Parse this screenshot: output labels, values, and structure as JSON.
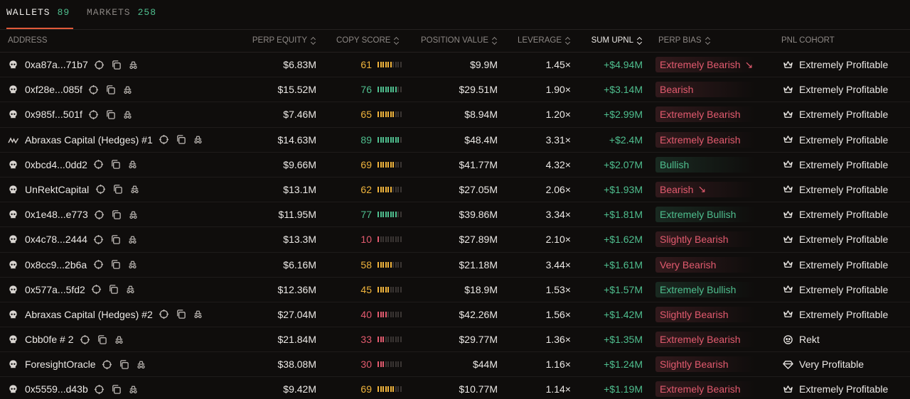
{
  "tabs": [
    {
      "label": "WALLETS",
      "count": "89",
      "active": true
    },
    {
      "label": "MARKETS",
      "count": "258",
      "active": false
    }
  ],
  "columns": {
    "address": "ADDRESS",
    "perp_equity": "PERP EQUITY",
    "copy_score": "COPY SCORE",
    "position_value": "POSITION VALUE",
    "leverage": "LEVERAGE",
    "sum_upnl": "SUM UPNL",
    "perp_bias": "PERP BIAS",
    "pnl_cohort": "PNL COHORT"
  },
  "colors": {
    "accent": "#e25a3a",
    "positive": "#4fbf8f",
    "bearish": "#e35b6f",
    "score_high": "#4fbf8f",
    "score_mid": "#f0b43c",
    "score_low": "#e35b6f"
  },
  "rows": [
    {
      "avatar": "skull-icon",
      "address": "0xa87a...71b7",
      "equity": "$6.83M",
      "score": "61",
      "position": "$9.9M",
      "leverage": "1.45×",
      "upnl": "+$4.94M",
      "bias": "Extremely Bearish",
      "bias_tone": "bear",
      "bias_arrow": "↘",
      "cohort_icon": "crown-icon",
      "cohort": "Extremely Profitable"
    },
    {
      "avatar": "skull-icon",
      "address": "0xf28e...085f",
      "equity": "$15.52M",
      "score": "76",
      "position": "$29.51M",
      "leverage": "1.90×",
      "upnl": "+$3.14M",
      "bias": "Bearish",
      "bias_tone": "bear",
      "bias_arrow": "",
      "cohort_icon": "crown-icon",
      "cohort": "Extremely Profitable"
    },
    {
      "avatar": "skull-icon",
      "address": "0x985f...501f",
      "equity": "$7.46M",
      "score": "65",
      "position": "$8.94M",
      "leverage": "1.20×",
      "upnl": "+$2.99M",
      "bias": "Extremely Bearish",
      "bias_tone": "bear",
      "bias_arrow": "",
      "cohort_icon": "crown-icon",
      "cohort": "Extremely Profitable"
    },
    {
      "avatar": "abraxas-logo-icon",
      "address": "Abraxas Capital (Hedges) #1",
      "equity": "$14.63M",
      "score": "89",
      "position": "$48.4M",
      "leverage": "3.31×",
      "upnl": "+$2.4M",
      "bias": "Extremely Bearish",
      "bias_tone": "bear",
      "bias_arrow": "",
      "cohort_icon": "crown-icon",
      "cohort": "Extremely Profitable"
    },
    {
      "avatar": "skull-icon",
      "address": "0xbcd4...0dd2",
      "equity": "$9.66M",
      "score": "69",
      "position": "$41.77M",
      "leverage": "4.32×",
      "upnl": "+$2.07M",
      "bias": "Bullish",
      "bias_tone": "bull",
      "bias_arrow": "",
      "cohort_icon": "crown-icon",
      "cohort": "Extremely Profitable"
    },
    {
      "avatar": "skull-icon",
      "address": "UnRektCapital",
      "equity": "$13.1M",
      "score": "62",
      "position": "$27.05M",
      "leverage": "2.06×",
      "upnl": "+$1.93M",
      "bias": "Bearish",
      "bias_tone": "bear",
      "bias_arrow": "↘",
      "cohort_icon": "crown-icon",
      "cohort": "Extremely Profitable"
    },
    {
      "avatar": "skull-icon",
      "address": "0x1e48...e773",
      "equity": "$11.95M",
      "score": "77",
      "position": "$39.86M",
      "leverage": "3.34×",
      "upnl": "+$1.81M",
      "bias": "Extremely Bullish",
      "bias_tone": "bull",
      "bias_arrow": "",
      "cohort_icon": "crown-icon",
      "cohort": "Extremely Profitable"
    },
    {
      "avatar": "skull-icon",
      "address": "0x4c78...2444",
      "equity": "$13.3M",
      "score": "10",
      "position": "$27.89M",
      "leverage": "2.10×",
      "upnl": "+$1.62M",
      "bias": "Slightly Bearish",
      "bias_tone": "bear",
      "bias_arrow": "",
      "cohort_icon": "crown-icon",
      "cohort": "Extremely Profitable"
    },
    {
      "avatar": "skull-icon",
      "address": "0x8cc9...2b6a",
      "equity": "$6.16M",
      "score": "58",
      "position": "$21.18M",
      "leverage": "3.44×",
      "upnl": "+$1.61M",
      "bias": "Very Bearish",
      "bias_tone": "bear",
      "bias_arrow": "",
      "cohort_icon": "crown-icon",
      "cohort": "Extremely Profitable"
    },
    {
      "avatar": "skull-icon",
      "address": "0x577a...5fd2",
      "equity": "$12.36M",
      "score": "45",
      "position": "$18.9M",
      "leverage": "1.53×",
      "upnl": "+$1.57M",
      "bias": "Extremely Bullish",
      "bias_tone": "bull",
      "bias_arrow": "",
      "cohort_icon": "crown-icon",
      "cohort": "Extremely Profitable"
    },
    {
      "avatar": "skull-icon",
      "address": "Abraxas Capital (Hedges) #2",
      "equity": "$27.04M",
      "score": "40",
      "position": "$42.26M",
      "leverage": "1.56×",
      "upnl": "+$1.42M",
      "bias": "Slightly Bearish",
      "bias_tone": "bear",
      "bias_arrow": "",
      "cohort_icon": "crown-icon",
      "cohort": "Extremely Profitable"
    },
    {
      "avatar": "skull-icon",
      "address": "Cbb0fe # 2",
      "equity": "$21.84M",
      "score": "33",
      "position": "$29.77M",
      "leverage": "1.36×",
      "upnl": "+$1.35M",
      "bias": "Extremely Bearish",
      "bias_tone": "bear",
      "bias_arrow": "",
      "cohort_icon": "rekt-face-icon",
      "cohort": "Rekt"
    },
    {
      "avatar": "skull-icon",
      "address": "ForesightOracle",
      "equity": "$38.08M",
      "score": "30",
      "position": "$44M",
      "leverage": "1.16×",
      "upnl": "+$1.24M",
      "bias": "Slightly Bearish",
      "bias_tone": "bear",
      "bias_arrow": "",
      "cohort_icon": "diamond-icon",
      "cohort": "Very Profitable"
    },
    {
      "avatar": "skull-icon",
      "address": "0x5559...d43b",
      "equity": "$9.42M",
      "score": "69",
      "position": "$10.77M",
      "leverage": "1.14×",
      "upnl": "+$1.19M",
      "bias": "Extremely Bearish",
      "bias_tone": "bear",
      "bias_arrow": "",
      "cohort_icon": "crown-icon",
      "cohort": "Extremely Profitable"
    }
  ]
}
